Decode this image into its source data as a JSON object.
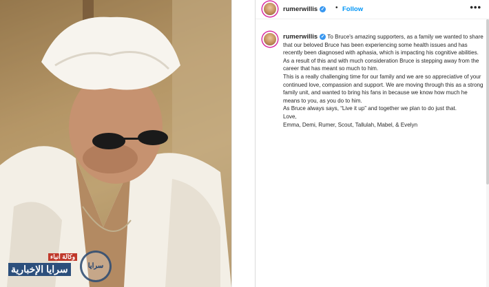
{
  "post": {
    "username": "rumerwillis",
    "follow_label": "Follow",
    "more_label": "•••",
    "dot": "•",
    "verified_icon": "check-icon",
    "caption": {
      "lines": [
        "To Bruce's amazing supporters, as a family we wanted to share that our beloved Bruce has been experiencing some health issues and has recently been diagnosed with aphasia, which is impacting his cognitive abilities. As a result of this and with much consideration Bruce is stepping away from the career that has meant so much to him.",
        "This is a really challenging time for our family and we are so appreciative of your continued love, compassion and support. We are moving through this as a strong family unit, and wanted to bring his fans in because we know how much he means to you, as you do to him.",
        "As Bruce always says, “Live it up” and together we plan to do just that.",
        "Love,",
        "Emma, Demi, Rumer, Scout, Tallulah, Mabel, & Evelyn"
      ]
    }
  },
  "watermark": {
    "small_text": "وكالة أنباء",
    "large_text": "سرايا الإخبارية",
    "logo_text": "سرايا"
  },
  "colors": {
    "accent": "#0095f6",
    "verified": "#3897f0",
    "text": "#262626"
  }
}
